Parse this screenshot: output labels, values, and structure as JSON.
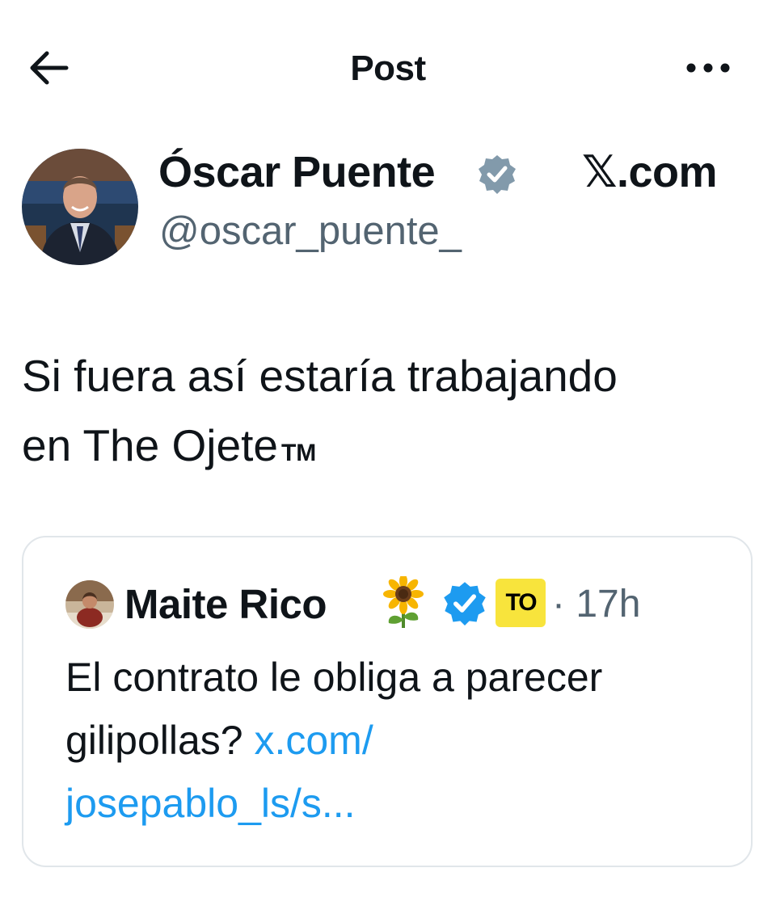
{
  "header": {
    "title": "Post"
  },
  "post": {
    "author_name": "Óscar Puente",
    "author_handle": "@oscar_puente_",
    "watermark": "𝕏.com",
    "text_line1": "Si fuera así estaría trabajando",
    "text_line2": "en The Ojete",
    "trademark": "TM"
  },
  "quoted_post": {
    "author_name": "Maite Rico",
    "affiliation_badge": "TO",
    "time": "· 17h",
    "text": "El contrato le obliga a parecer gilipollas? ",
    "link_line1": "x.com/",
    "link_line2": "josepablo_ls/s..."
  },
  "colors": {
    "text": "#0f1419",
    "secondary": "#536471",
    "link": "#1d9bf0",
    "verified_blue": "#1d9bf0",
    "verified_grey": "#829aab",
    "badge_yellow": "#f8e43c",
    "border": "#e1e6ea"
  },
  "icons": {
    "back": "arrow-left-icon",
    "more": "more-horizontal-icon",
    "verified_grey": "verified-grey-badge-icon",
    "verified_blue": "verified-blue-badge-icon",
    "sunflower": "sunflower-emoji-icon"
  }
}
